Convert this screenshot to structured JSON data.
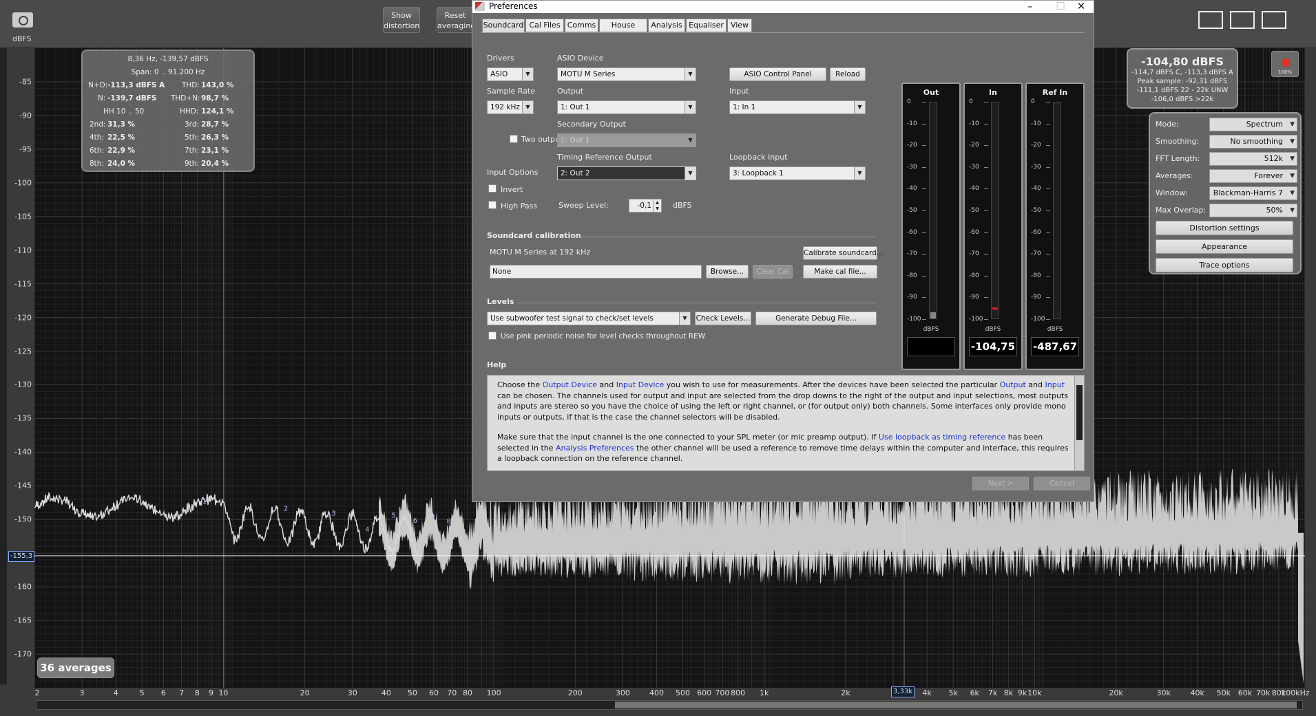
{
  "toolbar": {
    "show_distortion": "Show\ndistortion",
    "reset_averaging": "Reset\naveraging",
    "y_unit": "dBFS"
  },
  "graph": {
    "y_ticks": [
      "-85",
      "-90",
      "-95",
      "-100",
      "-105",
      "-110",
      "-115",
      "-120",
      "-125",
      "-130",
      "-135",
      "-140",
      "-145",
      "-150",
      "-155,3",
      "-160",
      "-165",
      "-170"
    ],
    "x_ticks": [
      "2",
      "3",
      "4",
      "5",
      "6",
      "7",
      "8",
      "9",
      "10",
      "20",
      "30",
      "40",
      "50",
      "60",
      "70",
      "80",
      "100",
      "200",
      "300",
      "400",
      "500",
      "600",
      "700",
      "800",
      "1k",
      "2k",
      "3",
      "3,33k",
      "4k",
      "5k",
      "6k",
      "7k",
      "8k",
      "9k",
      "10k",
      "20k",
      "30k",
      "40k",
      "50k",
      "60k",
      "70k",
      "80k",
      "100kHz"
    ],
    "cursor_y": "-155,3",
    "cursor_x": "3,33k",
    "harmonic_markers": [
      "1",
      "2",
      "3",
      "4",
      "5",
      "6",
      "7",
      "8",
      "9"
    ],
    "averages_badge": "36 averages"
  },
  "distortion_box": {
    "header1": "8,36 Hz, -139,57 dBFS",
    "header2": "Span: 0 .. 91.200 Hz",
    "nd_label": "N+D:",
    "nd_value": "-113,3 dBFS A",
    "thd_label": "THD:",
    "thd_value": "143,0 %",
    "n_label": "N:",
    "n_value": "-139,7 dBFS",
    "thdn_label": "THD+N:",
    "thdn_value": "98,7 %",
    "hh_label": "HH 10 .. 50",
    "hhd_label": "HHD:",
    "hhd_value": "124,1 %",
    "h2_label": "2nd:",
    "h2_value": "31,3 %",
    "h3_label": "3rd:",
    "h3_value": "28,7 %",
    "h4_label": "4th:",
    "h4_value": "22,5 %",
    "h5_label": "5th:",
    "h5_value": "26,3 %",
    "h6_label": "6th:",
    "h6_value": "22,9 %",
    "h7_label": "7th:",
    "h7_value": "23,1 %",
    "h8_label": "8th:",
    "h8_value": "24,0 %",
    "h9_label": "9th:",
    "h9_value": "20,4 %"
  },
  "peak_box": {
    "main": "-104,80 dBFS",
    "line1": "-114,7 dBFS C, -113,3 dBFS A",
    "line2": "Peak sample: -92,31 dBFS",
    "line3": "-111,1 dBFS 22 - 22k UNW",
    "line4": "-106,0 dBFS >22k",
    "rec_percent": "100%"
  },
  "analyser_settings": {
    "mode_label": "Mode:",
    "mode_value": "Spectrum",
    "smoothing_label": "Smoothing:",
    "smoothing_value": "No  smoothing",
    "fft_label": "FFT Length:",
    "fft_value": "512k",
    "averages_label": "Averages:",
    "averages_value": "Forever",
    "window_label": "Window:",
    "window_value": "Blackman-Harris 7",
    "overlap_label": "Max Overlap:",
    "overlap_value": "50%",
    "distortion_btn": "Distortion settings",
    "appearance_btn": "Appearance",
    "trace_btn": "Trace options"
  },
  "dialog": {
    "title": "Preferences",
    "tabs": [
      "Soundcard",
      "Cal Files",
      "Comms",
      "House Curve",
      "Analysis",
      "Equaliser",
      "View"
    ],
    "drivers_label": "Drivers",
    "drivers_value": "ASIO",
    "asio_device_label": "ASIO Device",
    "asio_device_value": "MOTU M Series",
    "asio_control_panel": "ASIO Control Panel",
    "reload": "Reload",
    "sample_rate_label": "Sample Rate",
    "sample_rate_value": "192 kHz",
    "output_label": "Output",
    "output_value": "1: Out 1",
    "input_label": "Input",
    "input_value": "1: In 1",
    "secondary_output_label": "Secondary Output",
    "secondary_output_value": "1: Out 1",
    "two_outputs_label": "Two outputs",
    "timing_ref_label": "Timing Reference Output",
    "timing_ref_value": "2: Out 2",
    "loopback_label": "Loopback Input",
    "loopback_value": "3: Loopback 1",
    "input_options_label": "Input Options",
    "invert_label": "Invert",
    "highpass_label": "High Pass",
    "sweep_level_label": "Sweep Level:",
    "sweep_level_value": "-0,1",
    "sweep_level_unit": "dBFS",
    "cal_section": "Soundcard calibration",
    "cal_device": "MOTU M Series at 192 kHz",
    "calibrate_btn": "Calibrate soundcard...",
    "cal_file_value": "None",
    "browse_btn": "Browse...",
    "clear_cal_btn": "Clear Cal",
    "make_cal_btn": "Make cal file...",
    "levels_section": "Levels",
    "levels_combo": "Use subwoofer test signal to check/set levels",
    "check_levels_btn": "Check Levels...",
    "debug_btn": "Generate Debug File...",
    "pink_noise_label": "Use pink periodic noise for level checks throughout REW",
    "help_section": "Help",
    "next_btn": "Next >",
    "cancel_btn": "Cancel"
  },
  "meters": {
    "scale": [
      "0",
      "-10",
      "-20",
      "-30",
      "-40",
      "-50",
      "-60",
      "-70",
      "-80",
      "-90",
      "-100"
    ],
    "unit": "dBFS",
    "out": {
      "title": "Out",
      "readout": "",
      "level": 0.03
    },
    "in": {
      "title": "In",
      "readout": "-104,75",
      "level": 0.0
    },
    "ref": {
      "title": "Ref In",
      "readout": "-487,67",
      "level": 0.0
    }
  },
  "help": {
    "p1_a": "Choose the ",
    "p1_l1": "Output Device",
    "p1_b": " and ",
    "p1_l2": "Input Device",
    "p1_c": " you wish to use for measurements. After the devices have been selected the particular ",
    "p1_l3": "Output",
    "p1_d": " and ",
    "p1_l4": "Input",
    "p1_e": " can be chosen. The channels used for output and input are selected from the drop downs to the right of the output and input selections, most outputs and inputs are stereo so you have the choice of using the left or right channel, or (for output only) both channels. Some interfaces only provide mono inputs or outputs, if that is the case the channel selectors will be disabled.",
    "p2_a": "Make sure that the input channel is the one connected to your SPL meter (or mic preamp output). If ",
    "p2_l1": "Use loopback as timing reference",
    "p2_b": " has been selected in the ",
    "p2_l2": "Analysis Preferences",
    "p2_c": " the other channel will be used a reference to remove time delays within the computer and interface, this requires a loopback connection on the reference channel."
  }
}
